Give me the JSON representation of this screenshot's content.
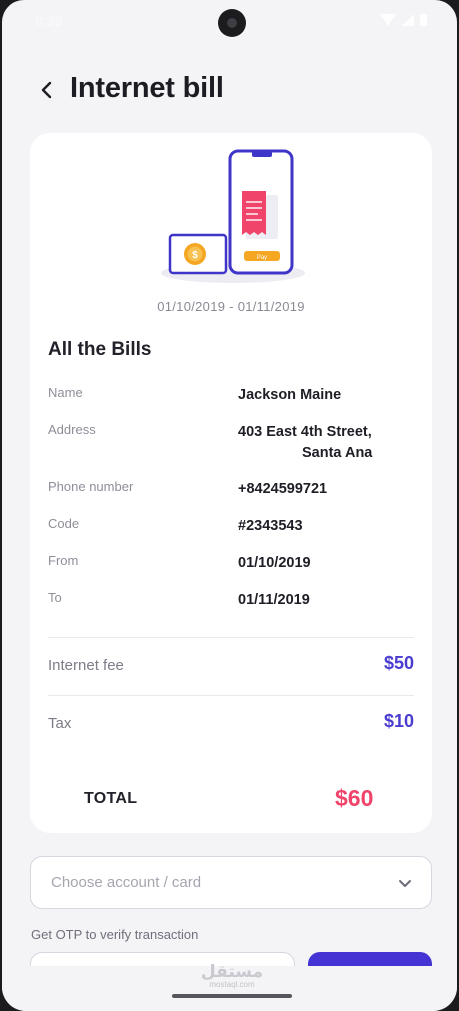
{
  "status_bar": {
    "time": "8:39"
  },
  "header": {
    "title": "Internet bill"
  },
  "bill": {
    "period": "01/10/2019 - 01/11/2019",
    "section_title": "All the Bills",
    "details": [
      {
        "label": "Name",
        "value": "Jackson Maine"
      },
      {
        "label": "Address",
        "value_line1": "403 East 4th Street,",
        "value_line2": "Santa Ana"
      },
      {
        "label": "Phone number",
        "value": "+8424599721"
      },
      {
        "label": "Code",
        "value": "#2343543"
      },
      {
        "label": "From",
        "value": "01/10/2019"
      },
      {
        "label": "To",
        "value": "01/11/2019"
      }
    ],
    "fees": [
      {
        "label": "Internet fee",
        "amount": "$50"
      },
      {
        "label": "Tax",
        "amount": "$10"
      }
    ],
    "total": {
      "label": "TOTAL",
      "amount": "$60"
    },
    "illustration": {
      "pay_button_label": "Pay",
      "coin_symbol": "$"
    }
  },
  "payment": {
    "account_select_placeholder": "Choose account / card",
    "otp_label": "Get OTP to verify transaction"
  },
  "watermark": {
    "arabic": "مستقل",
    "latin": "mostaql.com"
  },
  "colors": {
    "accent": "#4434d4",
    "total": "#f0446a",
    "background": "#f4f4f7"
  },
  "icons": [
    "back-arrow-icon",
    "chevron-down-icon",
    "wifi-icon",
    "signal-icon",
    "battery-icon"
  ]
}
